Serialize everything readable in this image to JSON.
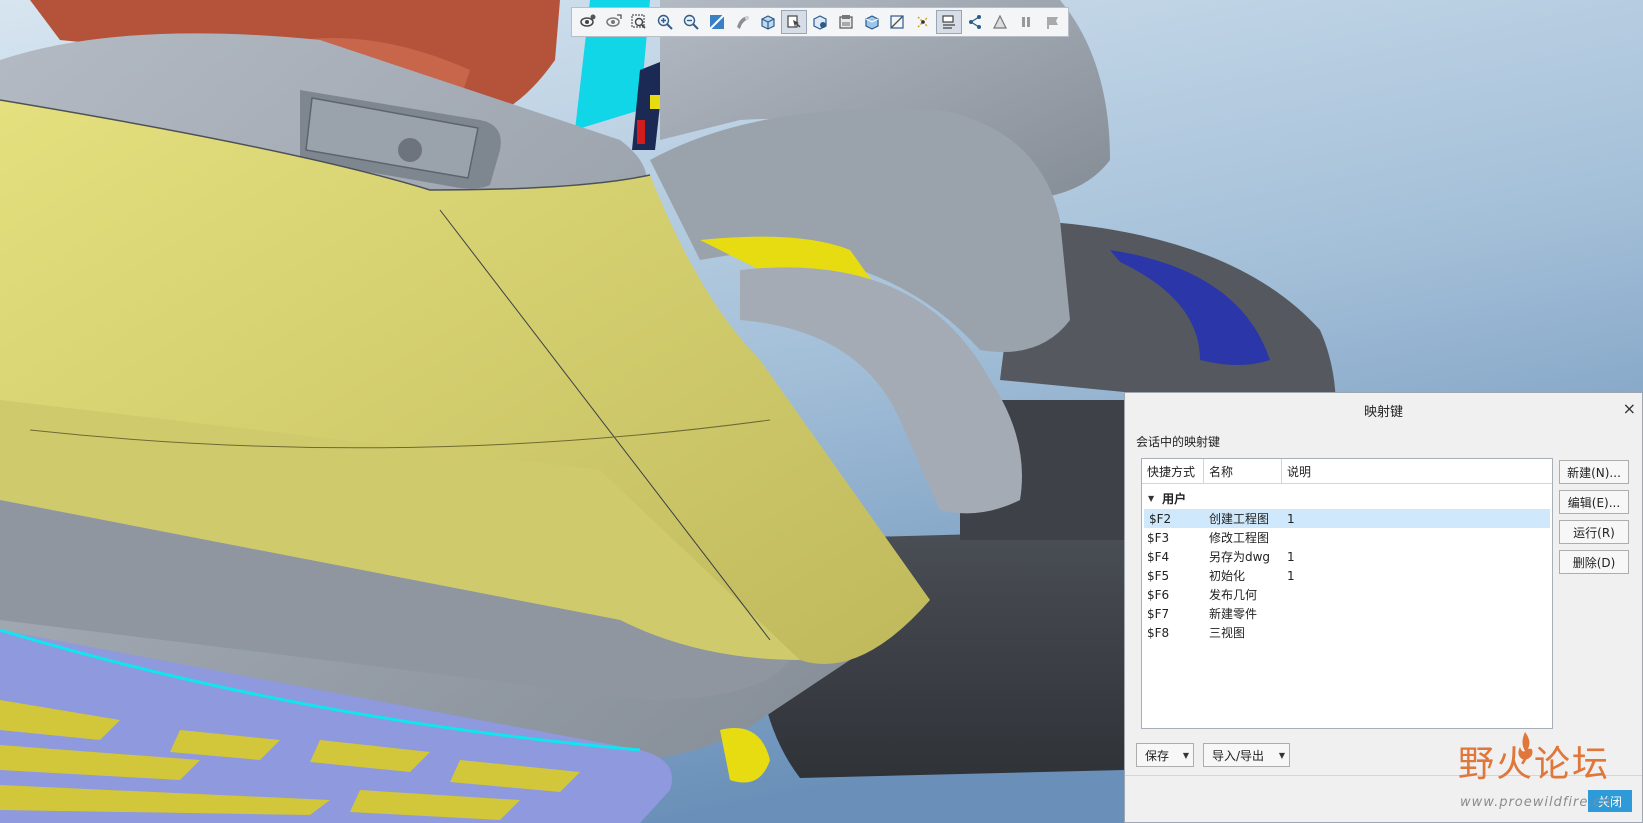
{
  "toolbar": {
    "buttons": [
      {
        "icon": "view-eye-icon"
      },
      {
        "icon": "view-eye-refit-icon"
      },
      {
        "icon": "zoom-window-icon"
      },
      {
        "icon": "zoom-in-icon"
      },
      {
        "icon": "zoom-out-icon"
      },
      {
        "icon": "repaint-icon"
      },
      {
        "icon": "shading-icon"
      },
      {
        "icon": "display-style-icon"
      },
      {
        "icon": "saved-orientations-icon",
        "active": true
      },
      {
        "icon": "named-views-icon"
      },
      {
        "icon": "view-manager-icon"
      },
      {
        "icon": "perspective-icon"
      },
      {
        "icon": "section-icon"
      },
      {
        "icon": "datum-display-icon"
      },
      {
        "icon": "annotation-display-icon",
        "active": true
      },
      {
        "icon": "spin-center-icon"
      },
      {
        "icon": "simplified-rep-icon"
      },
      {
        "icon": "pause-icon"
      },
      {
        "icon": "flag-icon"
      }
    ]
  },
  "dialog": {
    "title": "映射键",
    "close_glyph": "×",
    "subtitle": "会话中的映射键",
    "columns": [
      "快捷方式",
      "名称",
      "说明"
    ],
    "group_label": "用户",
    "rows": [
      {
        "key": "$F2",
        "name": "创建工程图",
        "desc": "1",
        "selected": true
      },
      {
        "key": "$F3",
        "name": "修改工程图",
        "desc": ""
      },
      {
        "key": "$F4",
        "name": "另存为dwg",
        "desc": "1"
      },
      {
        "key": "$F5",
        "name": "初始化",
        "desc": "1"
      },
      {
        "key": "$F6",
        "name": "发布几何",
        "desc": ""
      },
      {
        "key": "$F7",
        "name": "新建零件",
        "desc": ""
      },
      {
        "key": "$F8",
        "name": "三视图",
        "desc": ""
      }
    ],
    "buttons": {
      "new": "新建(N)...",
      "edit": "编辑(E)...",
      "run": "运行(R)",
      "delete": "删除(D)",
      "save": "保存",
      "import_export": "导入/导出",
      "close": "关闭"
    }
  },
  "watermark": {
    "title": "野火论坛",
    "url": "www.proewildfire.cn"
  },
  "colors": {
    "background_top": "#c9dceb",
    "background_bottom": "#6f95bd",
    "part_gray": "#8e969f",
    "part_yellow": "#d2cd6f",
    "part_red": "#b5533a",
    "part_cyan": "#10d6e8",
    "part_lavender": "#8e99de",
    "part_blue": "#2b36a8",
    "selection": "#cfe8fb",
    "close_button": "#2e9ad8",
    "watermark": "#e0763a"
  }
}
